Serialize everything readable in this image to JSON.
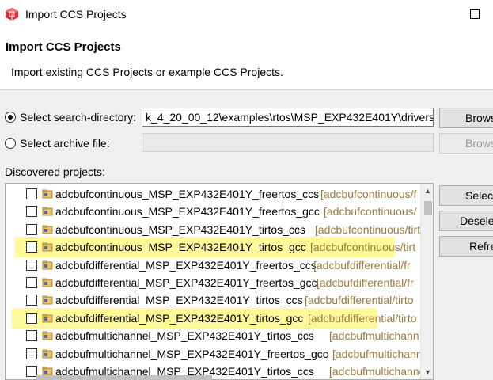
{
  "window": {
    "title": "Import CCS Projects",
    "app_icon": "ccs-cube-icon",
    "maximize_icon": "maximize-icon"
  },
  "header": {
    "title": "Import CCS Projects",
    "description": "Import existing CCS Projects or example CCS Projects."
  },
  "search_directory": {
    "label": "Select search-directory:",
    "value": "k_4_20_00_12\\examples\\rtos\\MSP_EXP432E401Y\\drivers",
    "selected": true,
    "browse_label": "Brows"
  },
  "archive_file": {
    "label": "Select archive file:",
    "value": "",
    "selected": false,
    "browse_label": "Brows"
  },
  "discovered": {
    "label": "Discovered projects:",
    "projects": [
      {
        "name": "adcbufcontinuous_MSP_EXP432E401Y_freertos_ccs",
        "path": "[adcbufcontinuous/f",
        "highlight": false
      },
      {
        "name": "adcbufcontinuous_MSP_EXP432E401Y_freertos_gcc",
        "path": "[adcbufcontinuous/",
        "highlight": false
      },
      {
        "name": "adcbufcontinuous_MSP_EXP432E401Y_tirtos_ccs",
        "path": "[adcbufcontinuous/tirto",
        "highlight": false
      },
      {
        "name": "adcbufcontinuous_MSP_EXP432E401Y_tirtos_gcc",
        "path": "[adcbufcontinuous/tirt",
        "highlight": true
      },
      {
        "name": "adcbufdifferential_MSP_EXP432E401Y_freertos_ccs",
        "path": "[adcbufdifferential/fr",
        "highlight": false
      },
      {
        "name": "adcbufdifferential_MSP_EXP432E401Y_freertos_gcc",
        "path": "[adcbufdifferential/fr",
        "highlight": false
      },
      {
        "name": "adcbufdifferential_MSP_EXP432E401Y_tirtos_ccs",
        "path": "[adcbufdifferential/tirto",
        "highlight": false
      },
      {
        "name": "adcbufdifferential_MSP_EXP432E401Y_tirtos_gcc",
        "path": "[adcbufdifferential/tirto",
        "highlight": true
      },
      {
        "name": "adcbufmultichannel_MSP_EXP432E401Y_tirtos_ccs",
        "path": "[adcbufmultichann",
        "highlight": false
      },
      {
        "name": "adcbufmultichannel_MSP_EXP432E401Y_freertos_gcc",
        "path": "[adcbufmultichann",
        "highlight": false
      },
      {
        "name": "adcbufmultichannel_MSP_EXP432E401Y_tirtos_ccs",
        "path": "[adcbufmultichannel/t",
        "highlight": false
      }
    ]
  },
  "side_buttons": {
    "select": "Select",
    "deselect": "Deselec",
    "refresh": "Refre"
  },
  "colors": {
    "highlight": "#fff99a",
    "path_text": "#9c7a3c",
    "icon_red": "#e3262f"
  }
}
